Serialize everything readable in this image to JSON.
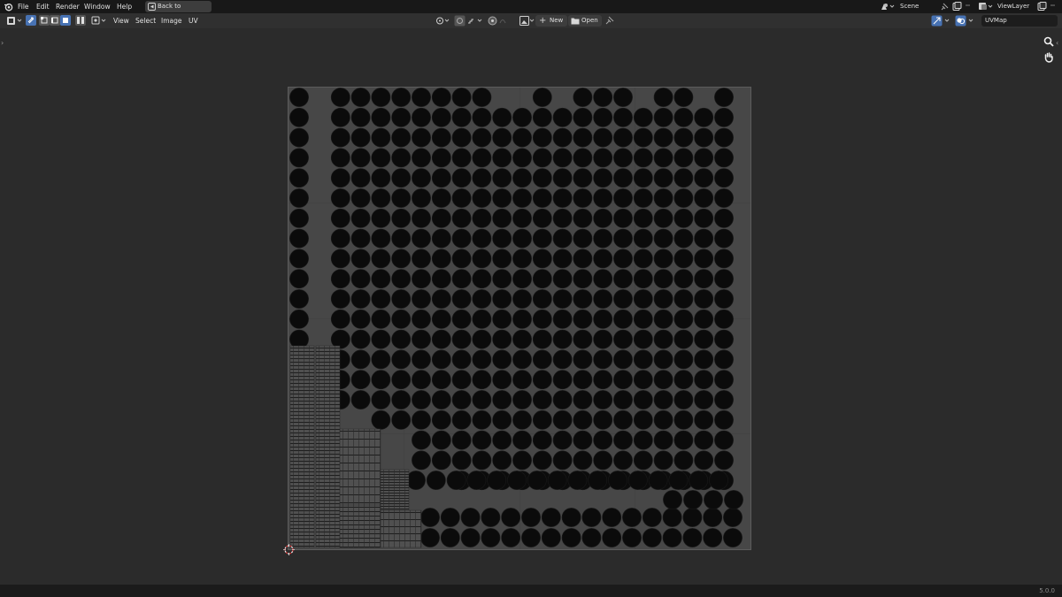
{
  "topbar": {
    "menus": [
      "File",
      "Edit",
      "Render",
      "Window",
      "Help"
    ],
    "back_button": "Back to Previous",
    "scene": "Scene",
    "view_layer": "ViewLayer"
  },
  "editor_header": {
    "menus": [
      "View",
      "Select",
      "Image",
      "UV"
    ],
    "new_label": "New",
    "open_label": "Open",
    "uv_map": "UVMap"
  },
  "status": {
    "version": "5.0.0"
  },
  "colors": {
    "accent": "#4772b3",
    "canvas": "#474747",
    "island": "#0b0b0b",
    "background": "#2b2b2b"
  },
  "icons": [
    "blender-logo-icon",
    "rewind-icon",
    "editor-type-icon",
    "uv-sync-icon",
    "vertex-select-icon",
    "edge-select-icon",
    "face-select-icon",
    "island-select-icon",
    "sticky-selection-icon",
    "pivot-icon",
    "proportional-edit-icon",
    "snap-icon",
    "overlay-icon",
    "gizmo-icon",
    "image-browse-icon",
    "plus-icon",
    "folder-icon",
    "pin-icon",
    "scene-icon",
    "view-layer-icon",
    "zoom-icon",
    "hand-icon",
    "cursor-icon"
  ]
}
